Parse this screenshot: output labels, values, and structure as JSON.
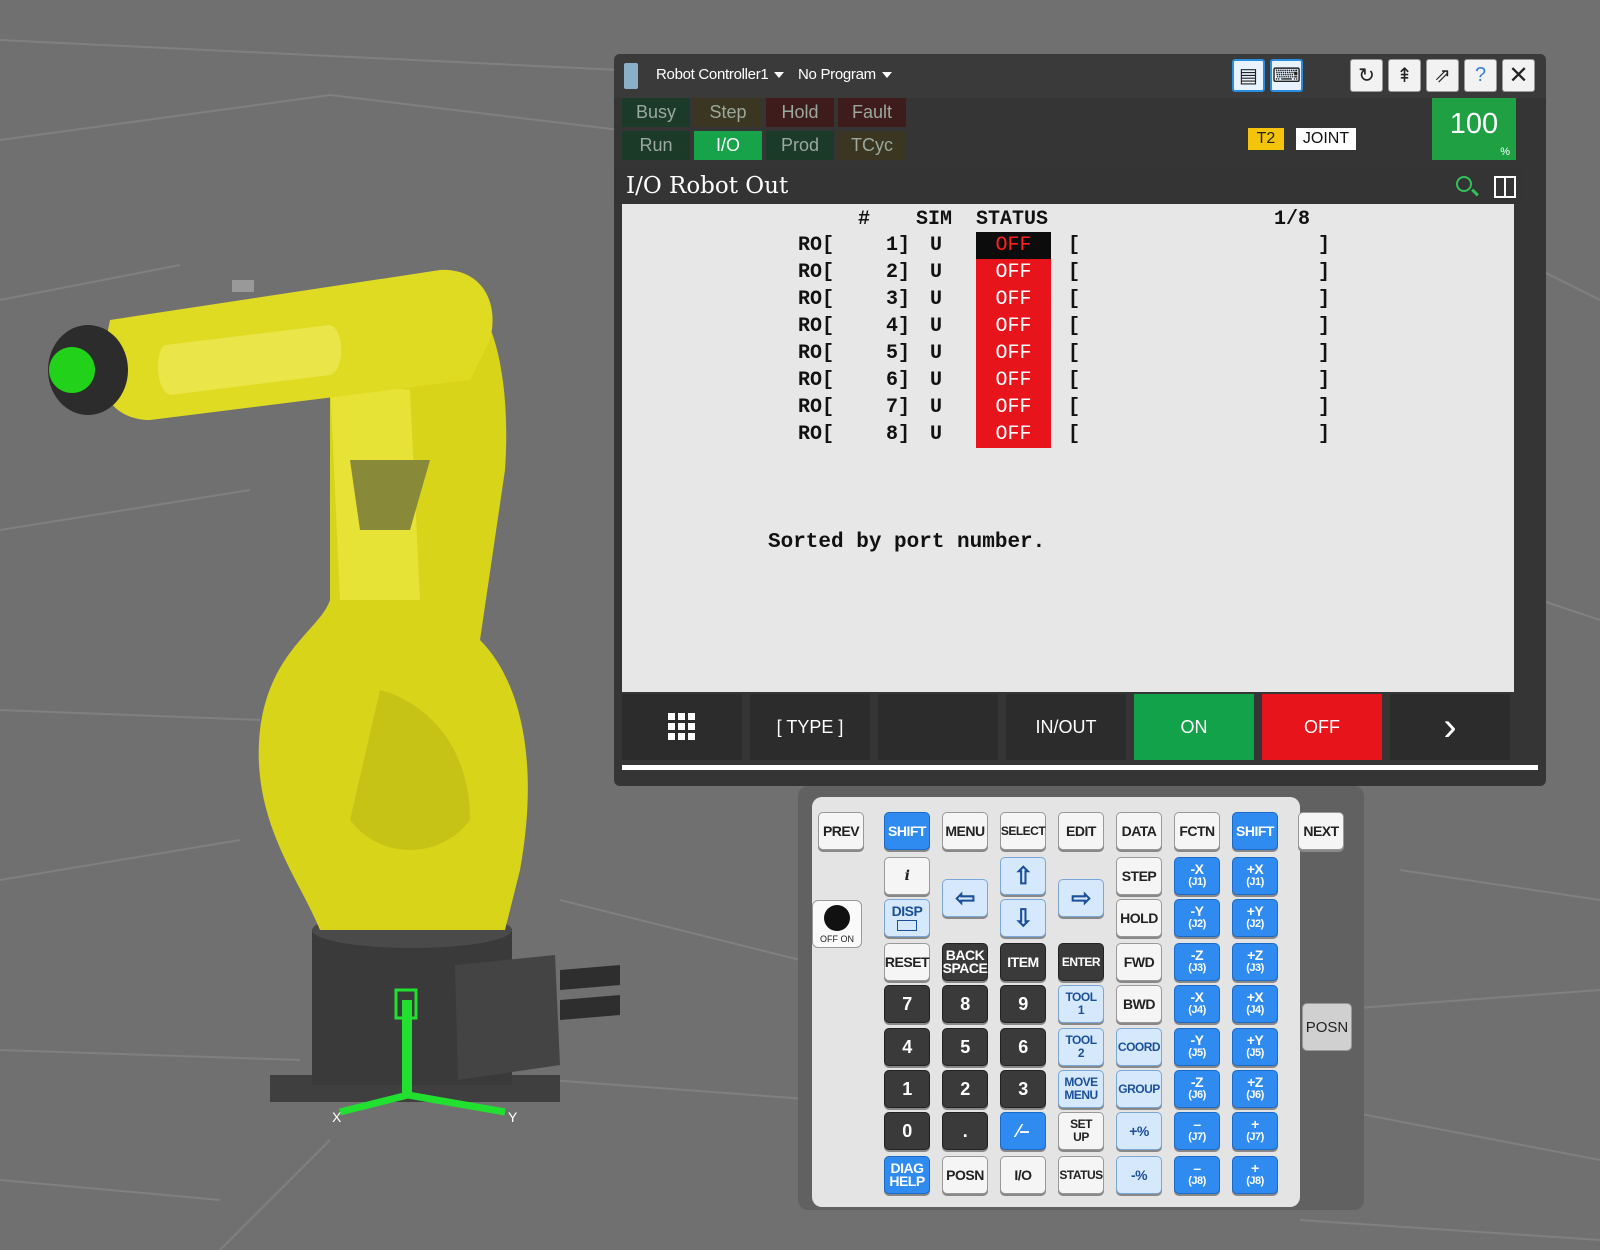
{
  "window": {
    "controller_label": "Robot Controller1",
    "program_label": "No Program"
  },
  "status": {
    "busy": "Busy",
    "step": "Step",
    "hold": "Hold",
    "fault": "Fault",
    "run": "Run",
    "io": "I/O",
    "prod": "Prod",
    "tcyc": "TCyc",
    "mode": "T2",
    "coord": "JOINT",
    "override": "100",
    "override_unit": "%"
  },
  "screen": {
    "title": "I/O Robot Out",
    "header": {
      "num": "#",
      "sim": "SIM",
      "status": "STATUS",
      "page": "1/8"
    },
    "rows": [
      {
        "type": "RO[",
        "num": "1]",
        "sim": "U",
        "status": "OFF",
        "open": "[",
        "close": "]"
      },
      {
        "type": "RO[",
        "num": "2]",
        "sim": "U",
        "status": "OFF",
        "open": "[",
        "close": "]"
      },
      {
        "type": "RO[",
        "num": "3]",
        "sim": "U",
        "status": "OFF",
        "open": "[",
        "close": "]"
      },
      {
        "type": "RO[",
        "num": "4]",
        "sim": "U",
        "status": "OFF",
        "open": "[",
        "close": "]"
      },
      {
        "type": "RO[",
        "num": "5]",
        "sim": "U",
        "status": "OFF",
        "open": "[",
        "close": "]"
      },
      {
        "type": "RO[",
        "num": "6]",
        "sim": "U",
        "status": "OFF",
        "open": "[",
        "close": "]"
      },
      {
        "type": "RO[",
        "num": "7]",
        "sim": "U",
        "status": "OFF",
        "open": "[",
        "close": "]"
      },
      {
        "type": "RO[",
        "num": "8]",
        "sim": "U",
        "status": "OFF",
        "open": "[",
        "close": "]"
      }
    ],
    "footer_note": "Sorted by port number."
  },
  "fkeys": {
    "f1": "[ TYPE ]",
    "f2": "",
    "f3": "IN/OUT",
    "f4": "ON",
    "f5": "OFF"
  },
  "keypad": {
    "prev": "PREV",
    "shift": "SHIFT",
    "menu": "MENU",
    "select": "SELECT",
    "edit": "EDIT",
    "data": "DATA",
    "fctn": "FCTN",
    "next": "NEXT",
    "info": "i",
    "disp": "DISP",
    "step": "STEP",
    "hold": "HOLD",
    "reset": "RESET",
    "backspace_1": "BACK",
    "backspace_2": "SPACE",
    "item": "ITEM",
    "enter": "ENTER",
    "fwd": "FWD",
    "bwd": "BWD",
    "n7": "7",
    "n8": "8",
    "n9": "9",
    "n4": "4",
    "n5": "5",
    "n6": "6",
    "n1": "1",
    "n2": "2",
    "n3": "3",
    "n0": "0",
    "dot": ".",
    "tool1_1": "TOOL",
    "tool1_2": "1",
    "tool2_1": "TOOL",
    "tool2_2": "2",
    "coord": "COORD",
    "group": "GROUP",
    "move_1": "MOVE",
    "move_2": "MENU",
    "setup_1": "SET",
    "setup_2": "UP",
    "diag_1": "DIAG",
    "diag_2": "HELP",
    "posn": "POSN",
    "io": "I/O",
    "status": "STATUS",
    "plus_pct": "+%",
    "minus_pct": "-%",
    "jx_neg": "-X",
    "jx_pos": "+X",
    "j1": "(J1)",
    "jy_neg": "-Y",
    "jy_pos": "+Y",
    "j2": "(J2)",
    "jz_neg": "-Z",
    "jz_pos": "+Z",
    "j3": "(J3)",
    "j4": "(J4)",
    "j5": "(J5)",
    "j6": "(J6)",
    "j7": "(J7)",
    "j8": "(J8)",
    "minus": "–",
    "plus": "+",
    "onoff_label": "OFF  ON",
    "posn_side": "POSN"
  },
  "axis_labels": {
    "x": "X",
    "y": "Y"
  }
}
